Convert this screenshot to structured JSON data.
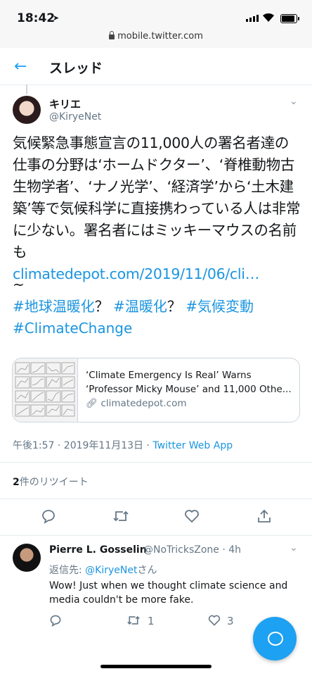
{
  "status_bar": {
    "time": "18:42"
  },
  "browser": {
    "url": "mobile.twitter.com"
  },
  "header": {
    "title": "スレッド"
  },
  "tweet": {
    "name": "キリエ",
    "handle": "@KiryeNet",
    "text": "気候緊急事態宣言の11,000人の署名者達の仕事の分野は‘ホームドクター’、‘脊椎動物古生物学者’、‘ナノ光学’、‘経済学’から‘土木建築’等で気候科学に直接携わっている人は非常に少ない。署名者にはミッキーマウスの名前も",
    "link": "climatedepot.com/2019/11/06/cli…",
    "tilde": "~",
    "hashtags": [
      "#地球温暖化",
      "？",
      "#温暖化",
      "？",
      "#気候変動",
      "#ClimateChange"
    ],
    "card": {
      "title_line1": "‘Climate Emergency Is Real’ Warns",
      "title_line2": "‘Professor Micky Mouse’ and 11,000 Othe...",
      "domain": "climatedepot.com"
    },
    "timestamp": "午後1:57 · 2019年11月13日 · ",
    "source": "Twitter Web App",
    "retweet_count": "2",
    "retweet_label": "件のリツイート"
  },
  "reply": {
    "name": "Pierre L. Gosselin",
    "handle": "@NoTricksZone · 4h",
    "reply_prefix": "返信先: ",
    "reply_to": "@KiryeNet",
    "reply_suffix": "さん",
    "text": "Wow! Just when we thought climate science and media couldn't be more fake.",
    "retweets": "1",
    "likes": "3"
  },
  "icons": [
    "location-arrow-icon",
    "signal-icon",
    "wifi-icon",
    "battery-icon",
    "lock-icon",
    "back-arrow-icon",
    "chevron-down-icon",
    "link-icon",
    "reply-icon",
    "retweet-icon",
    "like-icon",
    "share-icon",
    "compose-icon"
  ],
  "colors": {
    "accent": "#1da1f2",
    "link": "#1b95e0",
    "secondary_text": "#657786"
  }
}
